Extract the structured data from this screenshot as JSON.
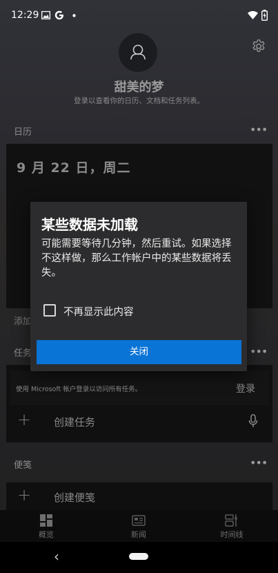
{
  "status_bar": {
    "time": "12:29",
    "left_icons": [
      "image-icon",
      "google-icon",
      "dot-icon"
    ],
    "right_icons": [
      "wifi-icon",
      "battery-charging-icon"
    ]
  },
  "profile": {
    "name": "甜美的梦",
    "subtitle": "登录以查看你的日历、文档和任务列表。"
  },
  "calendar": {
    "section_title": "日历",
    "date": "9 月 22 日，周二",
    "add_text_partial": "添加"
  },
  "tasks": {
    "section_title_partial": "任务",
    "signin_text": "使用 Microsoft 帐户登录以访问所有任务。",
    "signin_button": "登录",
    "create_task": "创建任务"
  },
  "notes": {
    "section_title": "便笺",
    "create_note": "创建便笺"
  },
  "bottom_nav": {
    "items": [
      {
        "label": "概览",
        "icon": "overview-icon",
        "active": true
      },
      {
        "label": "新闻",
        "icon": "news-icon",
        "active": false
      },
      {
        "label": "时间线",
        "icon": "timeline-icon",
        "active": false
      }
    ]
  },
  "dialog": {
    "title": "某些数据未加载",
    "body": "可能需要等待几分钟，然后重试。如果选择不这样做，那么工作帐户中的某些数据将丢失。",
    "checkbox_label": "不再显示此内容",
    "checkbox_checked": false,
    "button_label": "关闭",
    "button_color": "#0a74d6"
  },
  "more_glyph": "•••"
}
